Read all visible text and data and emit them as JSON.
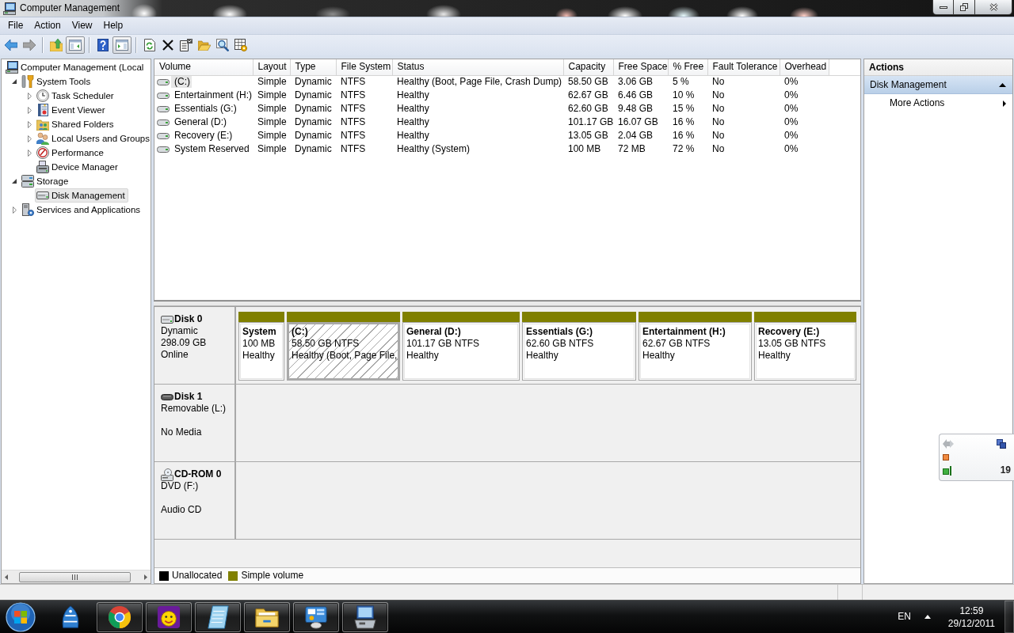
{
  "window": {
    "title": "Computer Management"
  },
  "menu": [
    "File",
    "Action",
    "View",
    "Help"
  ],
  "toolbar": [
    {
      "disabled": false,
      "pressed": false
    },
    {
      "disabled": true,
      "pressed": false
    },
    {
      "disabled": false,
      "pressed": false
    },
    {
      "disabled": false,
      "pressed": true
    },
    {
      "disabled": false,
      "pressed": false
    },
    {
      "disabled": false,
      "pressed": true
    },
    {
      "disabled": false,
      "pressed": false
    },
    {
      "disabled": false,
      "pressed": false
    },
    {
      "disabled": false,
      "pressed": false
    },
    {
      "disabled": false,
      "pressed": false
    },
    {
      "disabled": false,
      "pressed": false
    },
    {
      "disabled": false,
      "pressed": false
    }
  ],
  "tree": [
    {
      "label": "Computer Management (Local",
      "selected": false,
      "children": [
        {
          "label": "System Tools",
          "expanded": true,
          "selected": false,
          "children": [
            {
              "label": "Task Scheduler",
              "expanded": false,
              "selected": false
            },
            {
              "label": "Event Viewer",
              "expanded": false,
              "selected": false
            },
            {
              "label": "Shared Folders",
              "expanded": false,
              "selected": false
            },
            {
              "label": "Local Users and Groups",
              "expanded": false,
              "selected": false
            },
            {
              "label": "Performance",
              "expanded": false,
              "selected": false
            },
            {
              "label": "Device Manager",
              "selected": false
            }
          ]
        },
        {
          "label": "Storage",
          "expanded": true,
          "selected": false,
          "children": [
            {
              "label": "Disk Management",
              "selected": true
            }
          ]
        },
        {
          "label": "Services and Applications",
          "expanded": false,
          "selected": false
        }
      ]
    }
  ],
  "table": {
    "columns": [
      "Volume",
      "Layout",
      "Type",
      "File System",
      "Status",
      "Capacity",
      "Free Space",
      "% Free",
      "Fault Tolerance",
      "Overhead"
    ],
    "rows": [
      {
        "selected": true,
        "cells": [
          "(C:)",
          "Simple",
          "Dynamic",
          "NTFS",
          "Healthy (Boot, Page File, Crash Dump)",
          "58.50 GB",
          "3.06 GB",
          "5 %",
          "No",
          "0%"
        ]
      },
      {
        "selected": false,
        "cells": [
          "Entertainment (H:)",
          "Simple",
          "Dynamic",
          "NTFS",
          "Healthy",
          "62.67 GB",
          "6.46 GB",
          "10 %",
          "No",
          "0%"
        ]
      },
      {
        "selected": false,
        "cells": [
          "Essentials (G:)",
          "Simple",
          "Dynamic",
          "NTFS",
          "Healthy",
          "62.60 GB",
          "9.48 GB",
          "15 %",
          "No",
          "0%"
        ]
      },
      {
        "selected": false,
        "cells": [
          "General (D:)",
          "Simple",
          "Dynamic",
          "NTFS",
          "Healthy",
          "101.17 GB",
          "16.07 GB",
          "16 %",
          "No",
          "0%"
        ]
      },
      {
        "selected": false,
        "cells": [
          "Recovery (E:)",
          "Simple",
          "Dynamic",
          "NTFS",
          "Healthy",
          "13.05 GB",
          "2.04 GB",
          "16 %",
          "No",
          "0%"
        ]
      },
      {
        "selected": false,
        "cells": [
          "System Reserved",
          "Simple",
          "Dynamic",
          "NTFS",
          "Healthy (System)",
          "100 MB",
          "72 MB",
          "72 %",
          "No",
          "0%"
        ]
      }
    ]
  },
  "disks": [
    {
      "kind": "fixed",
      "name": "Disk 0",
      "info": [
        "Dynamic",
        "298.09 GB"
      ],
      "status": "Online",
      "partitions": [
        {
          "name": "System",
          "size": "100 MB",
          "status": "Healthy",
          "selected": false,
          "color": "#808000"
        },
        {
          "name": "(C:)",
          "size": "58.50 GB NTFS",
          "status": "Healthy (Boot, Page File,",
          "selected": true,
          "color": "#808000"
        },
        {
          "name": "General (D:)",
          "size": "101.17 GB NTFS",
          "status": "Healthy",
          "selected": false,
          "color": "#808000"
        },
        {
          "name": "Essentials (G:)",
          "size": "62.60 GB NTFS",
          "status": "Healthy",
          "selected": false,
          "color": "#808000"
        },
        {
          "name": "Entertainment (H:)",
          "size": "62.67 GB NTFS",
          "status": "Healthy",
          "selected": false,
          "color": "#808000"
        },
        {
          "name": "Recovery (E:)",
          "size": "13.05 GB NTFS",
          "status": "Healthy",
          "selected": false,
          "color": "#808000"
        }
      ]
    },
    {
      "kind": "removable",
      "name": "Disk 1",
      "info": [
        "Removable (L:)"
      ],
      "status": "No Media"
    },
    {
      "kind": "cdrom",
      "name": "CD-ROM 0",
      "info": [
        "DVD (F:)"
      ],
      "status": "Audio CD"
    }
  ],
  "legend": [
    {
      "label": "Unallocated",
      "color": "#000000"
    },
    {
      "label": "Simple volume",
      "color": "#808000"
    }
  ],
  "actions": {
    "title": "Actions",
    "sections": [
      {
        "label": "Disk Management",
        "expanded": true,
        "items": [
          "More Actions"
        ]
      }
    ]
  },
  "floating_widget": {
    "text": "19"
  },
  "taskbar": {
    "apps": [
      {
        "running": false
      },
      {
        "running": true
      },
      {
        "running": true
      },
      {
        "running": true
      },
      {
        "running": true
      },
      {
        "running": true
      },
      {
        "running": true
      }
    ],
    "language": "EN",
    "time": "12:59",
    "date": "29/12/2011"
  }
}
